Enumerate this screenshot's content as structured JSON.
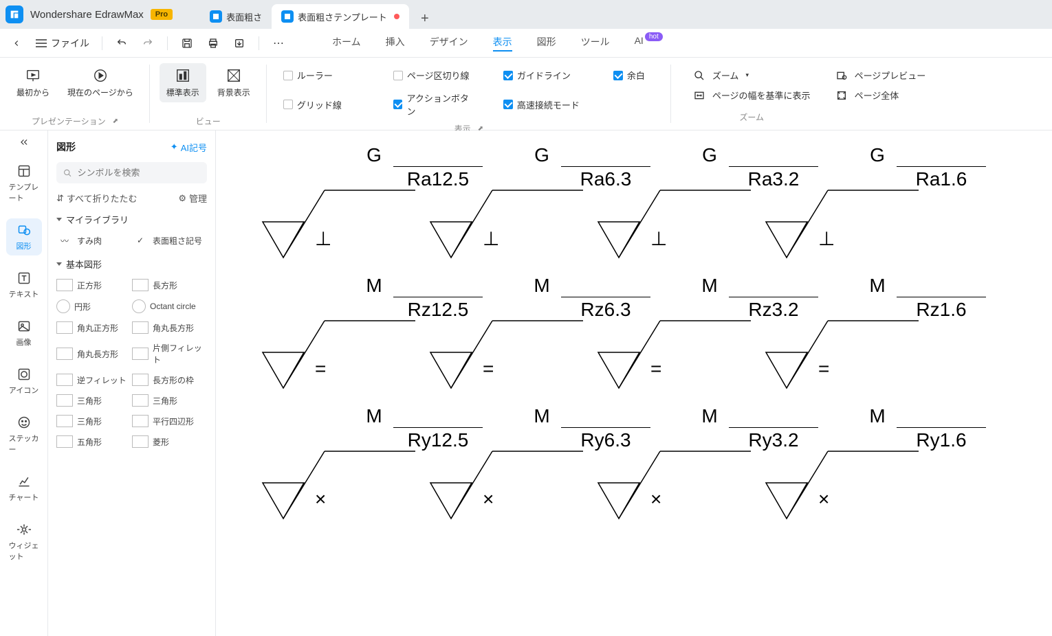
{
  "app": {
    "name": "Wondershare EdrawMax",
    "badge": "Pro"
  },
  "tabs": [
    {
      "label": "表面粗さ",
      "active": false,
      "dirty": false
    },
    {
      "label": "表面粗さテンプレート",
      "active": true,
      "dirty": true
    }
  ],
  "toolbar": {
    "file_label": "ファイル",
    "menu": {
      "home": "ホーム",
      "insert": "挿入",
      "design": "デザイン",
      "view": "表示",
      "shape": "図形",
      "tool": "ツール",
      "ai": "AI",
      "hot": "hot"
    }
  },
  "ribbon": {
    "presentation": {
      "from_start": "最初から",
      "from_current": "現在のページから",
      "title": "プレゼンテーション"
    },
    "view_mode": {
      "standard": "標準表示",
      "background": "背景表示",
      "title": "ビュー"
    },
    "display": {
      "ruler": "ルーラー",
      "grid": "グリッド線",
      "page_break": "ページ区切り線",
      "action_btn": "アクションボタン",
      "guideline": "ガイドライン",
      "fast_connect": "高速接続モード",
      "margin": "余白",
      "title": "表示"
    },
    "zoom": {
      "zoom": "ズーム",
      "fit_width": "ページの幅を基準に表示",
      "preview": "ページプレビュー",
      "whole": "ページ全体",
      "title": "ズーム"
    }
  },
  "leftrail": {
    "template": "テンプレート",
    "shape": "図形",
    "text": "テキスト",
    "image": "画像",
    "icon": "アイコン",
    "sticker": "ステッカー",
    "chart": "チャート",
    "widget": "ウィジェット"
  },
  "shapes": {
    "title": "図形",
    "ai_symbol": "AI記号",
    "search_placeholder": "シンボルを検索",
    "collapse_all": "すべて折りたたむ",
    "manage": "管理",
    "my_library": "マイライブラリ",
    "lib_items": [
      {
        "label": "すみ肉"
      },
      {
        "label": "表面粗さ記号"
      }
    ],
    "basic": "基本図形",
    "basic_items": [
      "正方形",
      "長方形",
      "円形",
      "Octant circle",
      "角丸正方形",
      "角丸長方形",
      "角丸長方形",
      "片側フィレット",
      "逆フィレット",
      "長方形の枠",
      "三角形",
      "三角形",
      "三角形",
      "平行四辺形",
      "五角形",
      "菱形"
    ]
  },
  "symbols": [
    {
      "top": "G",
      "val": "Ra12.5",
      "lay": "⊥"
    },
    {
      "top": "G",
      "val": "Ra6.3",
      "lay": "⊥"
    },
    {
      "top": "G",
      "val": "Ra3.2",
      "lay": "⊥"
    },
    {
      "top": "G",
      "val": "Ra1.6",
      "lay": "⊥"
    },
    {
      "top": "M",
      "val": "Rz12.5",
      "lay": "="
    },
    {
      "top": "M",
      "val": "Rz6.3",
      "lay": "="
    },
    {
      "top": "M",
      "val": "Rz3.2",
      "lay": "="
    },
    {
      "top": "M",
      "val": "Rz1.6",
      "lay": "="
    },
    {
      "top": "M",
      "val": "Ry12.5",
      "lay": "×"
    },
    {
      "top": "M",
      "val": "Ry6.3",
      "lay": "×"
    },
    {
      "top": "M",
      "val": "Ry3.2",
      "lay": "×"
    },
    {
      "top": "M",
      "val": "Ry1.6",
      "lay": "×"
    }
  ]
}
